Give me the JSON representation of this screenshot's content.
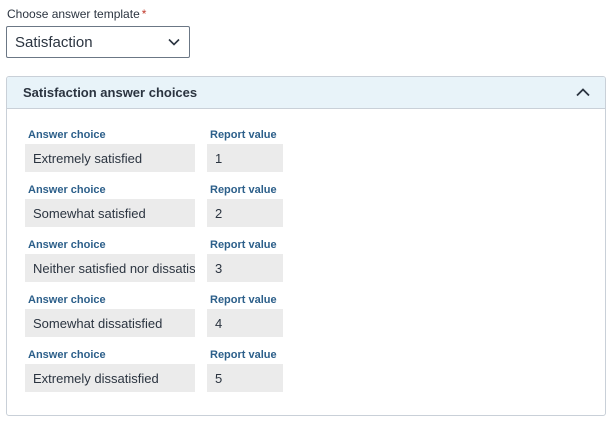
{
  "template": {
    "label": "Choose answer template",
    "required_marker": "*",
    "selected": "Satisfaction"
  },
  "panel": {
    "title": "Satisfaction answer choices",
    "expanded": true
  },
  "columns": {
    "answer_choice": "Answer choice",
    "report_value": "Report value"
  },
  "choices": [
    {
      "answer": "Extremely satisfied",
      "report": "1"
    },
    {
      "answer": "Somewhat satisfied",
      "report": "2"
    },
    {
      "answer": "Neither satisfied nor dissatisfied",
      "report": "3"
    },
    {
      "answer": "Somewhat dissatisfied",
      "report": "4"
    },
    {
      "answer": "Extremely dissatisfied",
      "report": "5"
    }
  ],
  "colors": {
    "header_bg": "#e8f3f9",
    "label_blue": "#2c5f8a",
    "field_bg": "#ebebeb",
    "required": "#c0392b"
  }
}
